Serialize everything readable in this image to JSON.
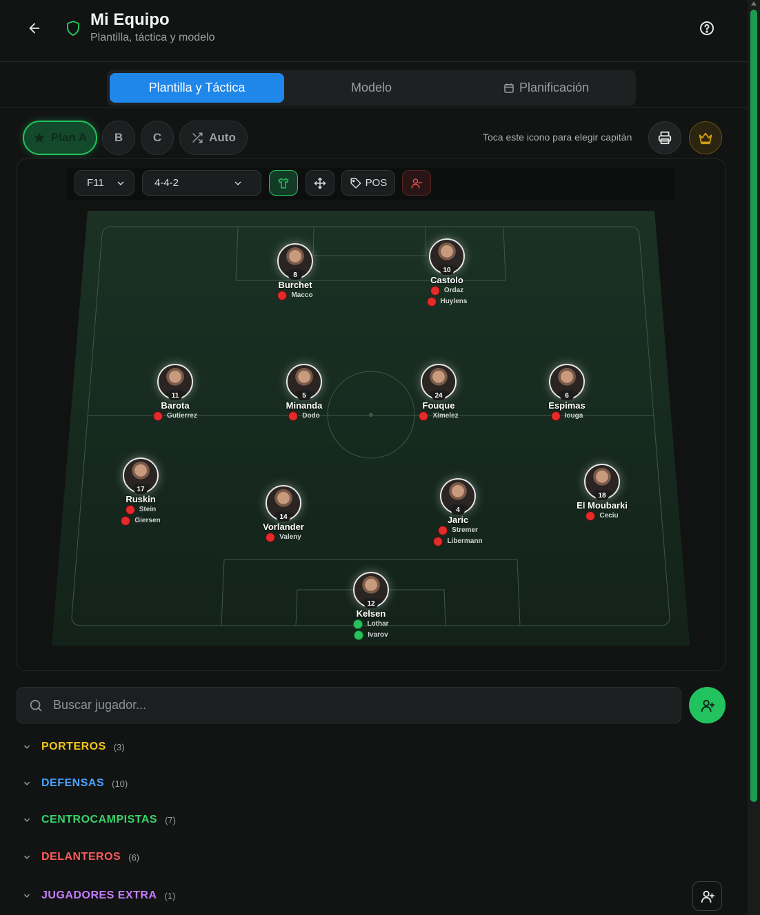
{
  "header": {
    "title": "Mi Equipo",
    "subtitle": "Plantilla, táctica y modelo"
  },
  "tabs": [
    {
      "label": "Plantilla y Táctica",
      "active": true
    },
    {
      "label": "Modelo",
      "active": false
    },
    {
      "label": "Planificación",
      "active": false
    }
  ],
  "plans": {
    "a": "Plan A",
    "b": "B",
    "c": "C",
    "auto": "Auto"
  },
  "captain_hint": "Toca este icono para elegir capitán",
  "toolbar": {
    "format": "F11",
    "formation": "4-4-2",
    "pos_label": "POS"
  },
  "players": [
    {
      "number": "8",
      "name": "Burchet",
      "subs": [
        {
          "name": "Macco",
          "status": "red"
        }
      ]
    },
    {
      "number": "10",
      "name": "Castolo",
      "subs": [
        {
          "name": "Ordaz",
          "status": "red"
        },
        {
          "name": "Huylens",
          "status": "red"
        }
      ]
    },
    {
      "number": "11",
      "name": "Barota",
      "subs": [
        {
          "name": "Gutierrez",
          "status": "red"
        }
      ]
    },
    {
      "number": "5",
      "name": "Minanda",
      "subs": [
        {
          "name": "Dodo",
          "status": "red"
        }
      ]
    },
    {
      "number": "24",
      "name": "Fouque",
      "subs": [
        {
          "name": "Ximelez",
          "status": "red"
        }
      ]
    },
    {
      "number": "6",
      "name": "Espimas",
      "subs": [
        {
          "name": "Iouga",
          "status": "red"
        }
      ]
    },
    {
      "number": "17",
      "name": "Ruskin",
      "subs": [
        {
          "name": "Stein",
          "status": "red"
        },
        {
          "name": "Giersen",
          "status": "red"
        }
      ]
    },
    {
      "number": "14",
      "name": "Vorlander",
      "subs": [
        {
          "name": "Valeny",
          "status": "red"
        }
      ]
    },
    {
      "number": "4",
      "name": "Jaric",
      "subs": [
        {
          "name": "Stremer",
          "status": "red"
        },
        {
          "name": "Libermann",
          "status": "red"
        }
      ]
    },
    {
      "number": "18",
      "name": "El Moubarki",
      "subs": [
        {
          "name": "Ceciu",
          "status": "red"
        }
      ]
    },
    {
      "number": "12",
      "name": "Kelsen",
      "subs": [
        {
          "name": "Lothar",
          "status": "green"
        },
        {
          "name": "Ivarov",
          "status": "green"
        }
      ]
    }
  ],
  "search": {
    "placeholder": "Buscar jugador..."
  },
  "groups": [
    {
      "label": "PORTEROS",
      "count": "(3)",
      "color": "#f5c518"
    },
    {
      "label": "DEFENSAS",
      "count": "(10)",
      "color": "#4aa3ff"
    },
    {
      "label": "CENTROCAMPISTAS",
      "count": "(7)",
      "color": "#38d46a"
    },
    {
      "label": "DELANTEROS",
      "count": "(6)",
      "color": "#ff5a5a"
    },
    {
      "label": "JUGADORES EXTRA",
      "count": "(1)",
      "color": "#c77dff"
    }
  ],
  "colors": {
    "accent_blue": "#1f86ea",
    "accent_green": "#22c35e",
    "captain_gold": "#d4a017"
  }
}
